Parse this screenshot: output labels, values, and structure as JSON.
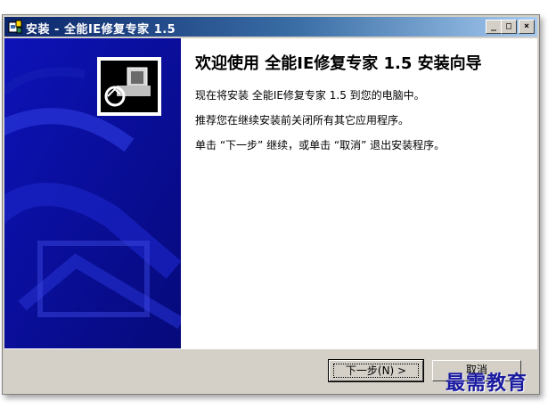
{
  "window": {
    "title": "安装 - 全能IE修复专家 1.5",
    "controls": {
      "minimize": "_",
      "maximize": "□",
      "close": "×"
    }
  },
  "wizard": {
    "heading": "欢迎使用 全能IE修复专家 1.5 安装向导",
    "paragraphs": [
      "现在将安装 全能IE修复专家 1.5 到您的电脑中。",
      "推荐您在继续安装前关闭所有其它应用程序。",
      "单击 “下一步” 继续，或单击 “取消” 退出安装程序。"
    ]
  },
  "buttons": {
    "next": "下一步(N) >",
    "cancel": "取消"
  },
  "watermark": "最需教育",
  "colors": {
    "side_panel": "#0a0fa6",
    "title_bar": "#0a246a",
    "dialog": "#d4d0c8"
  },
  "icons": [
    "installer-app-icon",
    "setup-computer-logo"
  ]
}
